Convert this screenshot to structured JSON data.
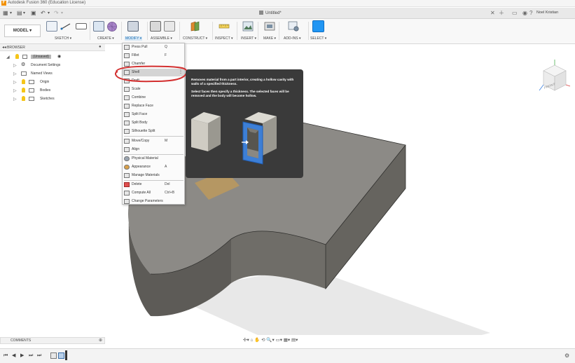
{
  "window": {
    "title": "Autodesk Fusion 360 (Education License)",
    "logo_letter": "F"
  },
  "tabbar": {
    "document_tab": "Untitled*",
    "user_name": "Noel Kristian",
    "quick_access": [
      "grid-menu-icon",
      "file-icon",
      "save-icon",
      "undo-icon",
      "redo-icon"
    ],
    "right_icons": [
      "close-tab-icon",
      "new-tab-icon",
      "job-status-icon",
      "notifications-icon",
      "help-icon"
    ]
  },
  "ribbon": {
    "workspace": "MODEL ▾",
    "groups": [
      {
        "label": "SKETCH ▾",
        "icon": "sketch-icon"
      },
      {
        "label": "CREATE ▾",
        "icon": "create-icon"
      },
      {
        "label": "MODIFY ▾",
        "icon": "modify-icon",
        "active": true
      },
      {
        "label": "ASSEMBLE ▾",
        "icon": "assemble-icon"
      },
      {
        "label": "CONSTRUCT ▾",
        "icon": "construct-icon"
      },
      {
        "label": "INSPECT ▾",
        "icon": "inspect-icon"
      },
      {
        "label": "INSERT ▾",
        "icon": "insert-icon"
      },
      {
        "label": "MAKE ▾",
        "icon": "make-icon"
      },
      {
        "label": "ADD-INS ▾",
        "icon": "addins-icon"
      },
      {
        "label": "SELECT ▾",
        "icon": "select-icon"
      }
    ]
  },
  "browser": {
    "title": "BROWSER",
    "items": [
      {
        "label": "(Unsaved)"
      },
      {
        "label": "Document Settings"
      },
      {
        "label": "Named Views"
      },
      {
        "label": "Origin"
      },
      {
        "label": "Bodies"
      },
      {
        "label": "Sketches"
      }
    ]
  },
  "modify_menu": {
    "items": [
      {
        "label": "Press Pull",
        "key": "Q"
      },
      {
        "label": "Fillet",
        "key": "F"
      },
      {
        "label": "Chamfer",
        "key": ""
      },
      {
        "label": "Shell",
        "key": "",
        "highlighted": true,
        "more": "⋮"
      },
      {
        "label": "Draft",
        "key": ""
      },
      {
        "label": "Scale",
        "key": ""
      },
      {
        "label": "Combine",
        "key": ""
      },
      {
        "label": "Replace Face",
        "key": ""
      },
      {
        "label": "Split Face",
        "key": ""
      },
      {
        "label": "Split Body",
        "key": ""
      },
      {
        "label": "Silhouette Split",
        "key": ""
      },
      {
        "label": "Move/Copy",
        "key": "M"
      },
      {
        "label": "Align",
        "key": ""
      },
      {
        "label": "Physical Material",
        "key": ""
      },
      {
        "label": "Appearance",
        "key": "A"
      },
      {
        "label": "Manage Materials",
        "key": ""
      },
      {
        "label": "Delete",
        "key": "Del"
      },
      {
        "label": "Compute All",
        "key": "Ctrl+B"
      },
      {
        "label": "Change Parameters",
        "key": ""
      }
    ]
  },
  "tooltip": {
    "line1": "Removes material from a part interior, creating a hollow cavity with walls of a specified thickness.",
    "line2": "Select faces then specify a thickness. The selected faces will be removed and the body will become hollow."
  },
  "viewcube": {
    "face_label": "FRONT"
  },
  "comments": {
    "title": "COMMENTS"
  },
  "nav_toolbar": {
    "icons_text": "✣▾ ⌂ ✋ ⟲ 🔍▾ ▭▾ ▦▾ ▤▾"
  },
  "timeline": {
    "buttons": [
      "⏮",
      "◀",
      "▶",
      "⏭",
      "⏭"
    ]
  },
  "colors": {
    "accent": "#2196f3",
    "highlight_ring": "#d32f2f",
    "tooltip_bg": "#3a3a3a",
    "body_top": "#9a9a97",
    "body_side": "#6b6b66"
  }
}
